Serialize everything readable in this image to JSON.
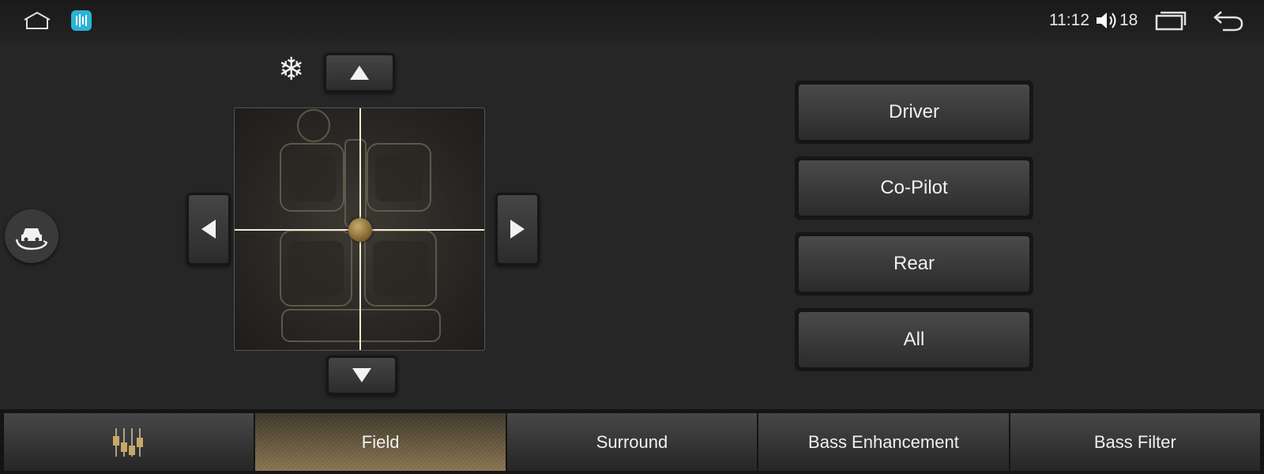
{
  "status_bar": {
    "time": "11:12",
    "volume_level": "18",
    "icons": [
      "home-icon",
      "app-launcher-icon",
      "volume-icon",
      "recents-icon",
      "back-icon"
    ]
  },
  "field_control": {
    "climate_icon": "snowflake-icon",
    "snowflake_glyph": "❄",
    "arrows": [
      "up",
      "down",
      "left",
      "right"
    ],
    "position_label": null
  },
  "zone_buttons": [
    {
      "label": "Driver"
    },
    {
      "label": "Co-Pilot"
    },
    {
      "label": "Rear"
    },
    {
      "label": "All"
    }
  ],
  "tabs": [
    {
      "label": "",
      "icon": "equalizer-icon",
      "active": false
    },
    {
      "label": "Field",
      "active": true
    },
    {
      "label": "Surround",
      "active": false
    },
    {
      "label": "Bass Enhancement",
      "active": false
    },
    {
      "label": "Bass Filter",
      "active": false
    }
  ],
  "colors": {
    "background": "#262626",
    "accent_gold": "#8a7650",
    "crosshair": "#f3ead2",
    "app_icon": "#2bb3d6"
  }
}
